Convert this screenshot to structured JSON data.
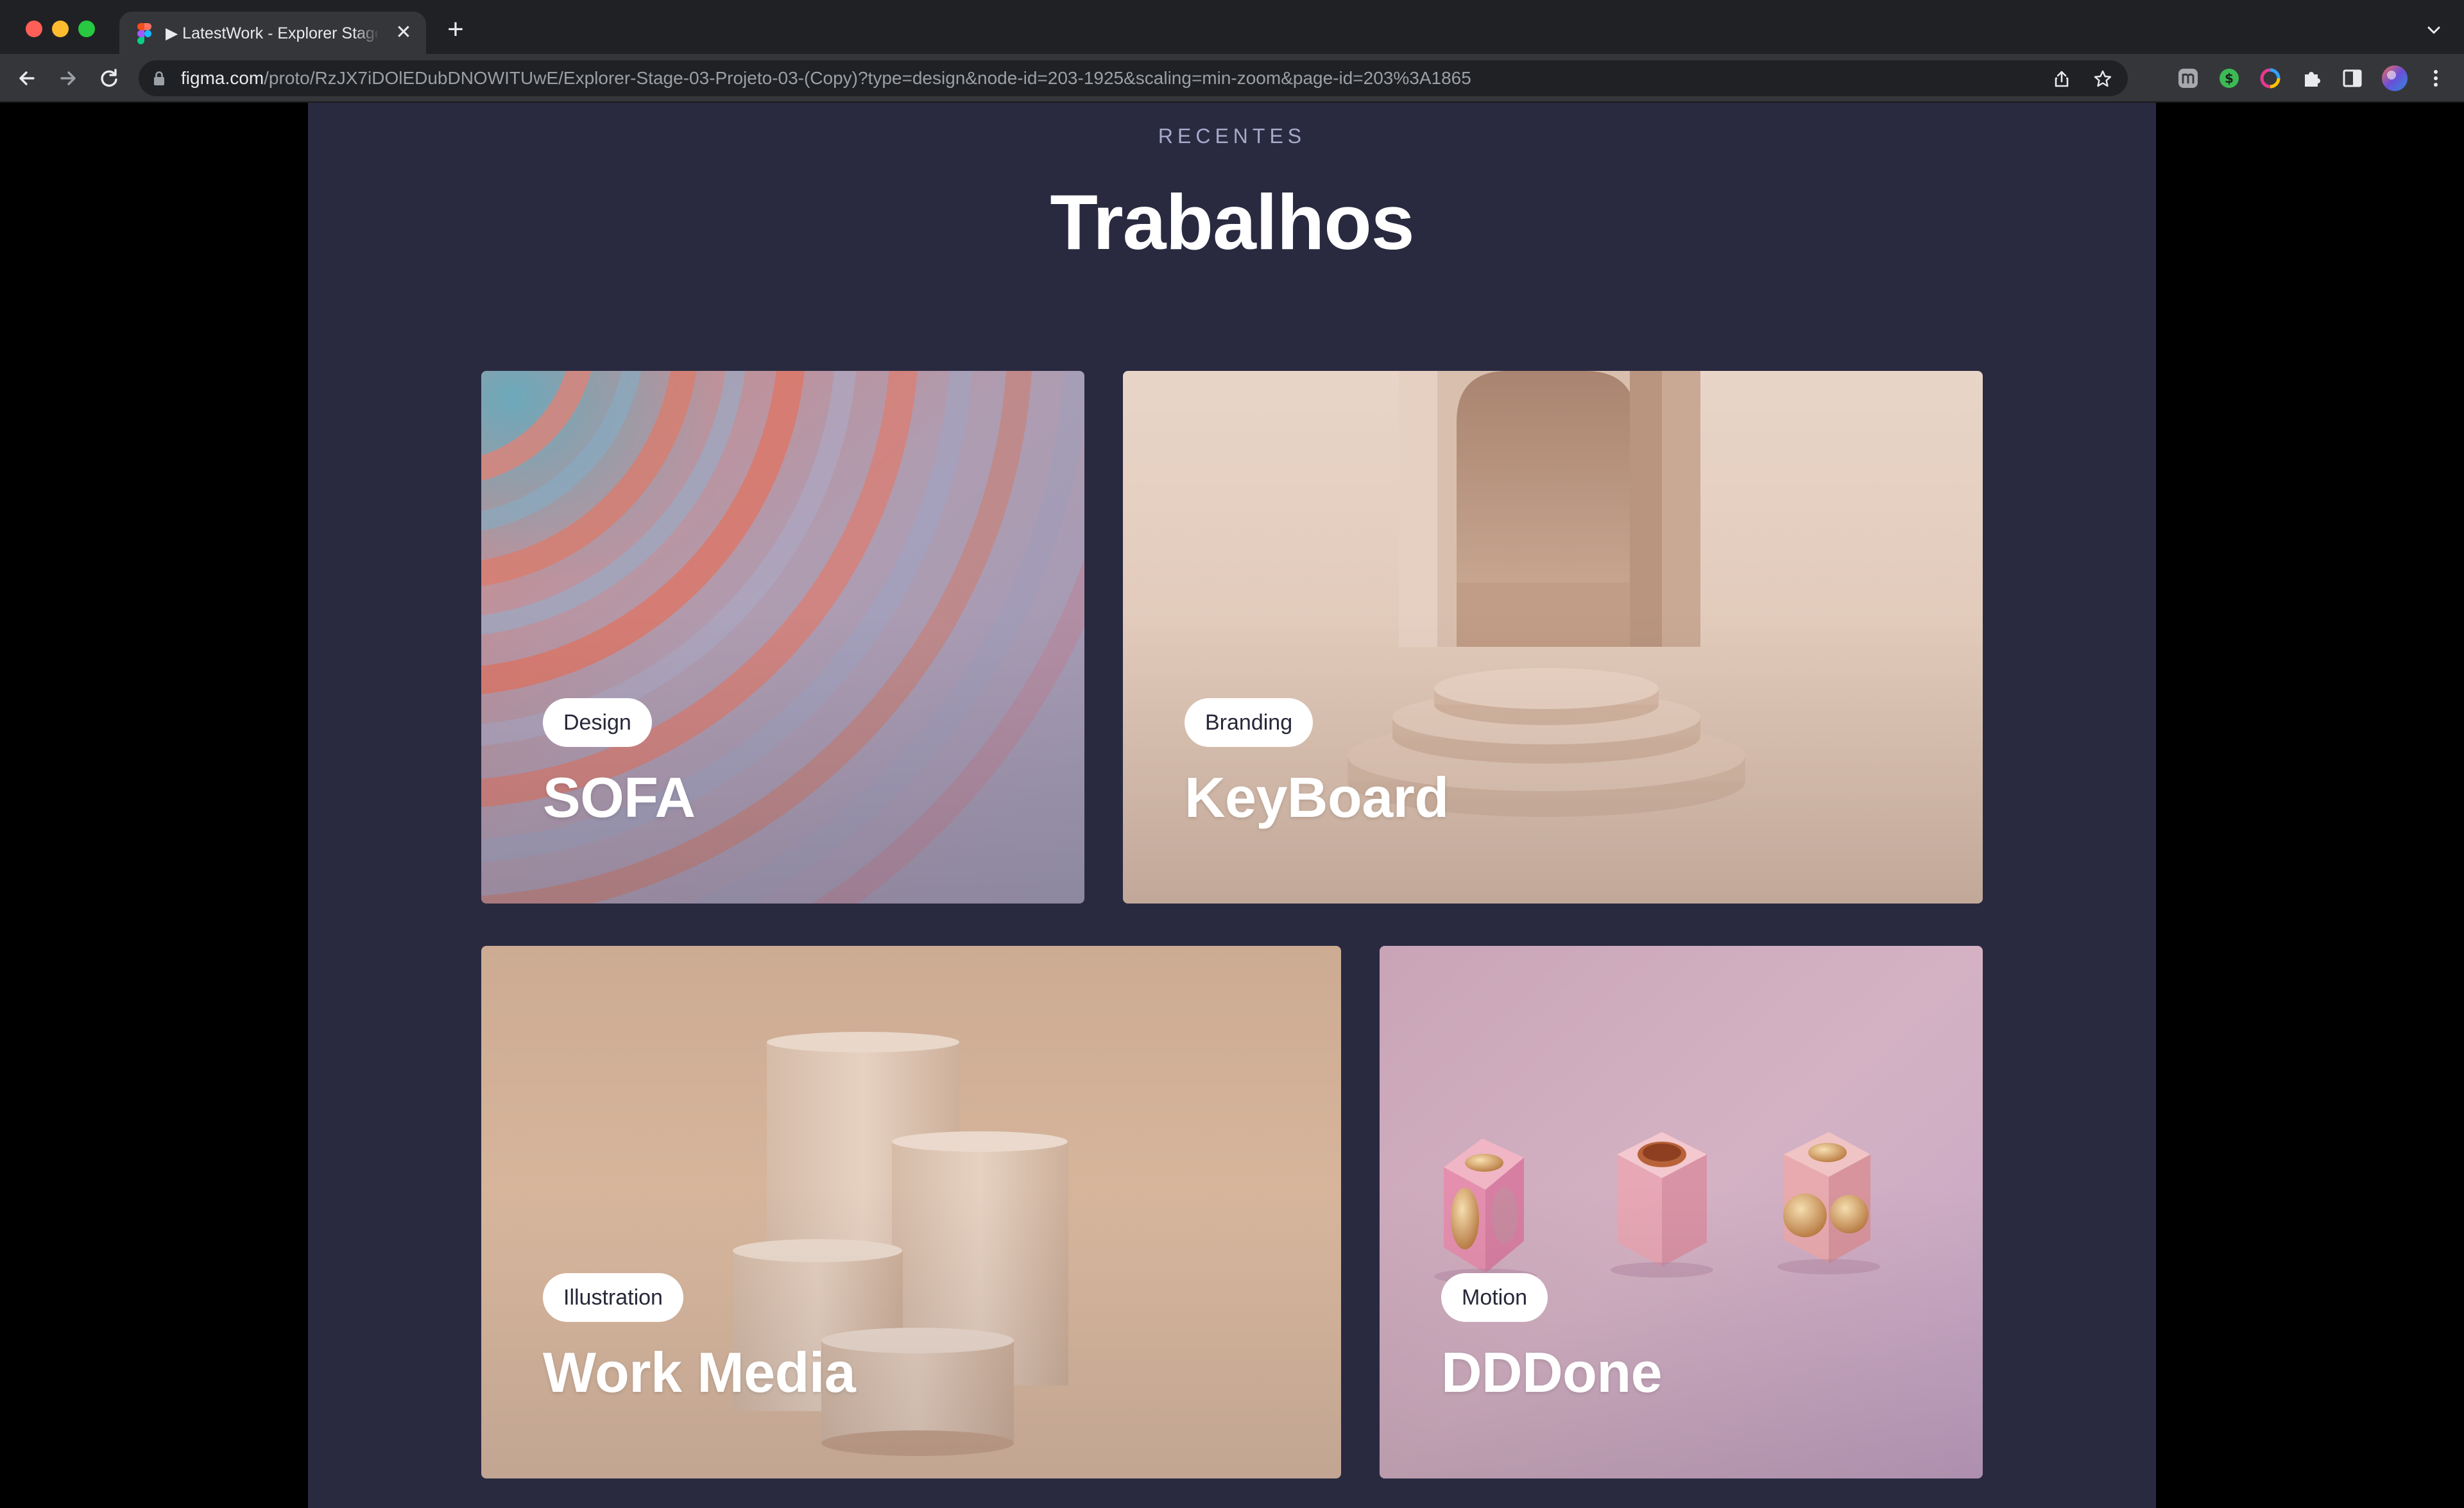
{
  "browser": {
    "tab_title": "▶ LatestWork - Explorer Stage 03",
    "new_tab_label": "+",
    "tab_close_label": "✕",
    "url_host": "figma.com",
    "url_path": "/proto/RzJX7iDOlEDubDNOWITUwE/Explorer-Stage-03-Projeto-03-(Copy)?type=design&node-id=203-1925&scaling=min-zoom&page-id=203%3A1865",
    "toolbar_icons": [
      "back-icon",
      "forward-icon",
      "reload-icon",
      "lock-icon",
      "share-icon",
      "bookmark-star-icon",
      "extension-m-icon",
      "extension-dollar-icon",
      "extension-ring-icon",
      "extensions-puzzle-icon",
      "side-panel-icon",
      "profile-avatar-icon",
      "menu-kebab-icon"
    ]
  },
  "page": {
    "eyebrow": "RECENTES",
    "title": "Trabalhos",
    "background": "#292a40",
    "cards": [
      {
        "tag": "Design",
        "title": "SOFA"
      },
      {
        "tag": "Branding",
        "title": "KeyBoard"
      },
      {
        "tag": "Illustration",
        "title": "Work Media"
      },
      {
        "tag": "Motion",
        "title": "DDDone"
      }
    ]
  }
}
